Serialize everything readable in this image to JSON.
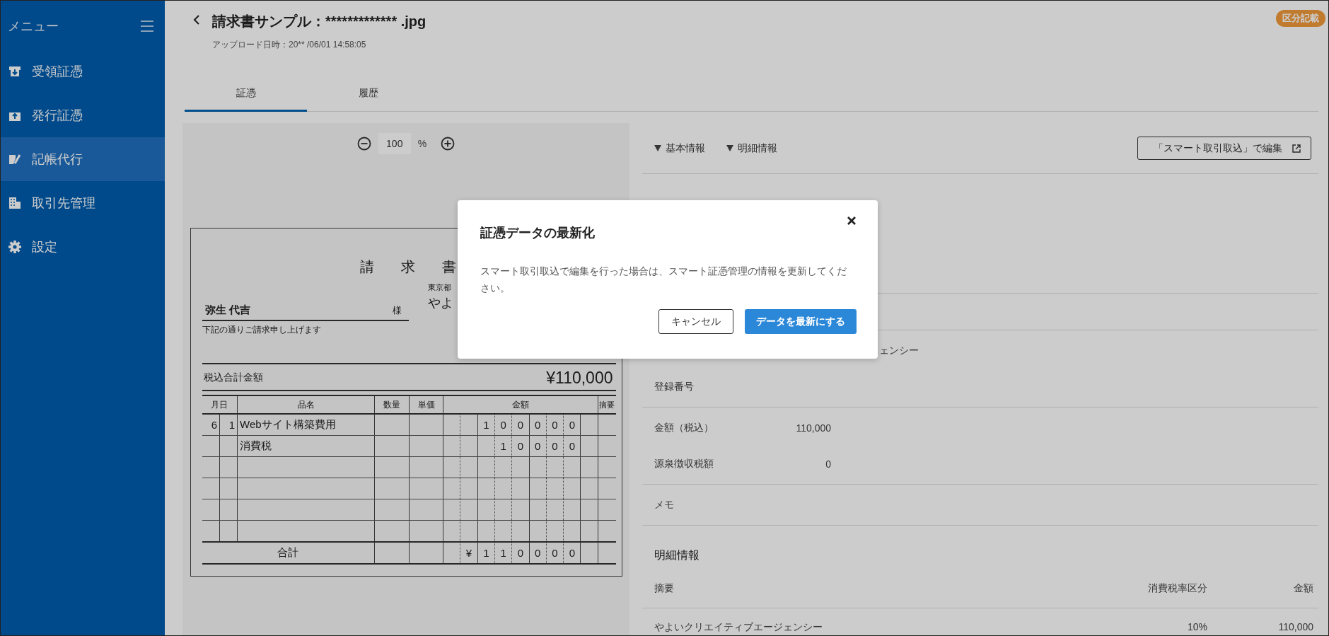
{
  "sidebar": {
    "title": "メニュー",
    "items": [
      {
        "label": "受領証憑",
        "selected": false
      },
      {
        "label": "発行証憑",
        "selected": false
      },
      {
        "label": "記帳代行",
        "selected": true
      },
      {
        "label": "取引先管理",
        "selected": false
      },
      {
        "label": "設定",
        "selected": false
      }
    ]
  },
  "header": {
    "title": "請求書サンプル：************* .jpg",
    "upload": "アップロード日時：20** /06/01 14:58:05",
    "badge": "区分記載"
  },
  "tabs": [
    {
      "label": "証憑",
      "selected": true
    },
    {
      "label": "履歴",
      "selected": false
    }
  ],
  "viewer": {
    "zoom": "100",
    "unit": "%",
    "document": {
      "title": "請 求 書",
      "customer": "弥生 代吉",
      "honorific": "様",
      "note": "下記の通りご請求申し上げます",
      "issuer_address": "東京都",
      "issuer_name": "やよ",
      "total_label": "税込合計金額",
      "total": "¥110,000",
      "columns": [
        "月日",
        "品名",
        "数量",
        "単価",
        "金額",
        "摘要"
      ],
      "rows": [
        {
          "kind": "item",
          "month": "6",
          "day": "1",
          "item": "Webサイト構築費用",
          "digits": [
            "1",
            "0",
            "0",
            "0",
            "0",
            "0"
          ]
        },
        {
          "kind": "item",
          "item": "消費税",
          "digits": [
            "1",
            "0",
            "0",
            "0",
            "0"
          ]
        },
        {
          "kind": "blank"
        },
        {
          "kind": "blank"
        },
        {
          "kind": "blank"
        },
        {
          "kind": "blank"
        }
      ],
      "sum": {
        "label": "合計",
        "currency": "¥",
        "digits": [
          "1",
          "1",
          "0",
          "0",
          "0",
          "0"
        ]
      }
    }
  },
  "details": {
    "toggles": [
      "基本情報",
      "明細情報"
    ],
    "edit_button": "「スマート取引取込」で編集",
    "groups": [
      [
        {
          "kind": "partial",
          "value": "ェンシー"
        },
        {
          "kind": "field",
          "label": "登録番号"
        }
      ],
      [
        {
          "kind": "field",
          "label": "金額（税込）",
          "value": "110,000"
        },
        {
          "kind": "field",
          "label": "源泉徴収税額",
          "value": "0"
        }
      ],
      [
        {
          "kind": "field",
          "label": "メモ"
        }
      ]
    ],
    "lines": {
      "heading": "明細情報",
      "columns": [
        "摘要",
        "消費税率区分",
        "金額"
      ],
      "rows": [
        [
          "やよいクリエイティブエージェンシー",
          "10%",
          "110,000"
        ]
      ]
    }
  },
  "dialog": {
    "title": "証憑データの最新化",
    "message": "スマート取引取込で編集を行った場合は、スマート証憑管理の情報を更新してください。",
    "cancel": "キャンセル",
    "confirm": "データを最新にする"
  }
}
